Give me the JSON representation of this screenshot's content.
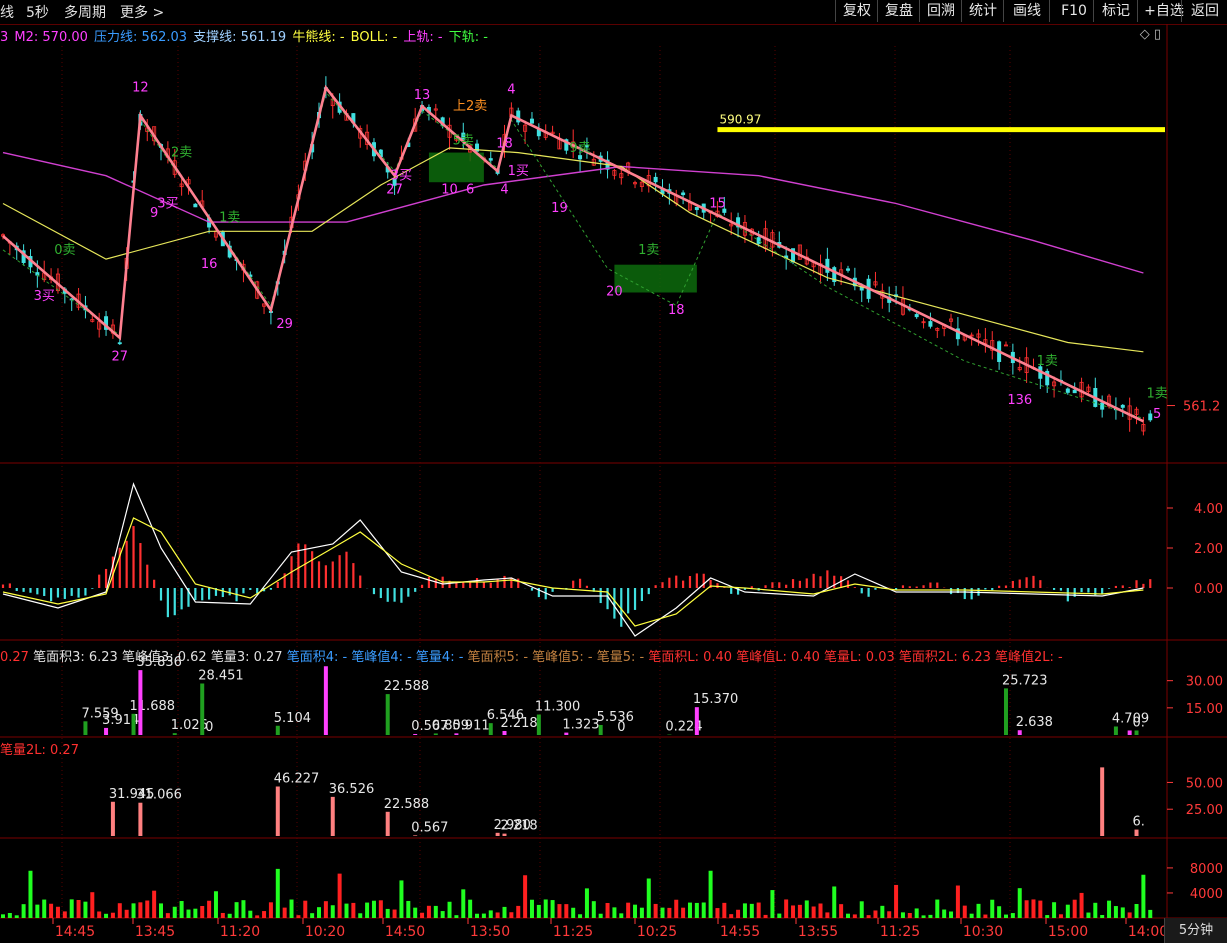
{
  "toolbar": {
    "left": [
      "线",
      "5秒",
      "多周期",
      "更多 >"
    ],
    "buttons": [
      "复权",
      "复盘",
      "回溯",
      "统计",
      "画线",
      "F10",
      "标记",
      "+自选",
      "返回"
    ]
  },
  "legend": [
    {
      "text": "3",
      "color": "#ff40ff"
    },
    {
      "text": "M2: 570.00",
      "color": "#ff40ff"
    },
    {
      "text": "压力线: 562.03",
      "color": "#3a9cff"
    },
    {
      "text": "支撑线: 561.19",
      "color": "#9fd0ff"
    },
    {
      "text": "牛熊线: -",
      "color": "#ffff40"
    },
    {
      "text": "BOLL: -",
      "color": "#ffff40"
    },
    {
      "text": "上轨: -",
      "color": "#ff40ff"
    },
    {
      "text": "下轨: -",
      "color": "#40ff40"
    }
  ],
  "legend2": [
    {
      "text": "0.27",
      "color": "#ff3030"
    },
    {
      "text": "笔面积3: 6.23",
      "color": "#e0e0e0"
    },
    {
      "text": "笔峰值3: 0.62",
      "color": "#e0e0e0"
    },
    {
      "text": "笔量3: 0.27",
      "color": "#e0e0e0"
    },
    {
      "text": "笔面积4: -",
      "color": "#3a9cff"
    },
    {
      "text": "笔峰值4: -",
      "color": "#3a9cff"
    },
    {
      "text": "笔量4: -",
      "color": "#3a9cff"
    },
    {
      "text": "笔面积5: -",
      "color": "#c08040"
    },
    {
      "text": "笔峰值5: -",
      "color": "#c08040"
    },
    {
      "text": "笔量5: -",
      "color": "#c08040"
    },
    {
      "text": "笔面积L: 0.40",
      "color": "#ff3030"
    },
    {
      "text": "笔峰值L: 0.40",
      "color": "#ff3030"
    },
    {
      "text": "笔量L: 0.03",
      "color": "#ff3030"
    },
    {
      "text": "笔面积2L: 6.23",
      "color": "#ff3030"
    },
    {
      "text": "笔峰值2L: -",
      "color": "#ff3030"
    }
  ],
  "legend3": "笔量2L: 0.27",
  "corner_icons": "◇ ▯",
  "bottom_tab": "5分钟",
  "chart_data": [
    {
      "type": "candlestick",
      "panel": "main",
      "current_price": "561.2",
      "price_range": [
        555,
        600
      ],
      "hline": {
        "label": "590.97",
        "value": 590.97
      },
      "pivots": [
        {
          "i": 0,
          "p": 579.5
        },
        {
          "i": 17,
          "p": 568.5,
          "label": "27"
        },
        {
          "i": 20,
          "p": 592.5,
          "label": "12"
        },
        {
          "i": 39,
          "p": 571.5,
          "label": "29"
        },
        {
          "i": 47,
          "p": 595.5
        },
        {
          "i": 57,
          "p": 586.0,
          "label": "27"
        },
        {
          "i": 61,
          "p": 593.5,
          "label": "13"
        },
        {
          "i": 72,
          "p": 586.5,
          "label": "4"
        },
        {
          "i": 74,
          "p": 592.5,
          "label": "4"
        },
        {
          "i": 166,
          "p": 559.5,
          "label": "5"
        }
      ],
      "boll_mid": [
        [
          0,
          583
        ],
        [
          15,
          577
        ],
        [
          30,
          580
        ],
        [
          45,
          580
        ],
        [
          55,
          585
        ],
        [
          65,
          589
        ],
        [
          75,
          588.5
        ],
        [
          90,
          587
        ],
        [
          100,
          582
        ],
        [
          120,
          575
        ],
        [
          140,
          571
        ],
        [
          155,
          568
        ],
        [
          166,
          567
        ]
      ],
      "boll_upper": [
        [
          0,
          588.5
        ],
        [
          15,
          586
        ],
        [
          30,
          581
        ],
        [
          50,
          581
        ],
        [
          70,
          585
        ],
        [
          90,
          587
        ],
        [
          110,
          586
        ],
        [
          130,
          583
        ],
        [
          150,
          579
        ],
        [
          166,
          575.5
        ]
      ],
      "pivot_labels": [
        {
          "text": "12",
          "i": 20,
          "p": 595.5,
          "color": "#ff40ff"
        },
        {
          "text": "27",
          "i": 17,
          "p": 566.5,
          "color": "#ff40ff"
        },
        {
          "text": "29",
          "i": 41,
          "p": 570.0,
          "color": "#ff40ff"
        },
        {
          "text": "27",
          "i": 57,
          "p": 584.5,
          "color": "#ff40ff"
        },
        {
          "text": "13",
          "i": 61,
          "p": 594.7,
          "color": "#ff40ff"
        },
        {
          "text": "4",
          "i": 74,
          "p": 595.3,
          "color": "#ff40ff"
        },
        {
          "text": "4",
          "i": 73,
          "p": 584.5,
          "color": "#ff40ff"
        },
        {
          "text": "9",
          "i": 22,
          "p": 582.0,
          "color": "#ff40ff"
        },
        {
          "text": "16",
          "i": 30,
          "p": 576.5,
          "color": "#ff40ff"
        },
        {
          "text": "10",
          "i": 65,
          "p": 584.5,
          "color": "#ff40ff"
        },
        {
          "text": "6",
          "i": 68,
          "p": 584.5,
          "color": "#ff40ff"
        },
        {
          "text": "18",
          "i": 73,
          "p": 589.5,
          "color": "#ff40ff"
        },
        {
          "text": "19",
          "i": 81,
          "p": 582.5,
          "color": "#ff40ff"
        },
        {
          "text": "20",
          "i": 89,
          "p": 573.5,
          "color": "#ff40ff"
        },
        {
          "text": "18",
          "i": 98,
          "p": 571.5,
          "color": "#ff40ff"
        },
        {
          "text": "15",
          "i": 104,
          "p": 583.0,
          "color": "#ff40ff"
        },
        {
          "text": "136",
          "i": 148,
          "p": 561.8,
          "color": "#ff40ff"
        },
        {
          "text": "5",
          "i": 168,
          "p": 560.3,
          "color": "#ff40ff"
        },
        {
          "text": "上2卖",
          "i": 68,
          "p": 593.5,
          "color": "#ff9020"
        },
        {
          "text": "3买",
          "i": 6,
          "p": 573.0,
          "color": "#ff40ff"
        },
        {
          "text": "3买",
          "i": 24,
          "p": 583.0,
          "color": "#ff40ff"
        },
        {
          "text": "3买",
          "i": 58,
          "p": 586.0,
          "color": "#ff40ff"
        },
        {
          "text": "1买",
          "i": 75,
          "p": 586.5,
          "color": "#ff40ff"
        },
        {
          "text": "2卖",
          "i": 26,
          "p": 588.5,
          "color": "#30b030"
        },
        {
          "text": "1卖",
          "i": 33,
          "p": 581.5,
          "color": "#30b030"
        },
        {
          "text": "0卖",
          "i": 9,
          "p": 578.0,
          "color": "#30b030"
        },
        {
          "text": "5卖",
          "i": 67,
          "p": 589.8,
          "color": "#30b030"
        },
        {
          "text": "9卖",
          "i": 84,
          "p": 589.0,
          "color": "#30b030"
        },
        {
          "text": "1卖",
          "i": 94,
          "p": 578.0,
          "color": "#30b030"
        },
        {
          "text": "1卖",
          "i": 152,
          "p": 566.0,
          "color": "#30b030"
        },
        {
          "text": "1卖",
          "i": 168,
          "p": 562.5,
          "color": "#30b030"
        }
      ]
    },
    {
      "type": "macd",
      "panel": "macd",
      "yticks": [
        "4.00",
        "2.00",
        "0.00"
      ],
      "ylim": [
        -2.6,
        5.4
      ],
      "hist": [
        [
          2,
          -0.2
        ],
        [
          8,
          -0.6
        ],
        [
          12,
          -0.4
        ],
        [
          16,
          1.5
        ],
        [
          19,
          3.0
        ],
        [
          21,
          1.2
        ],
        [
          24,
          -1.5
        ],
        [
          28,
          -0.6
        ],
        [
          34,
          -0.5
        ],
        [
          40,
          0.2
        ],
        [
          43,
          2.3
        ],
        [
          47,
          1.2
        ],
        [
          50,
          1.8
        ],
        [
          54,
          -0.4
        ],
        [
          58,
          -0.8
        ],
        [
          62,
          0.6
        ],
        [
          70,
          0.3
        ],
        [
          74,
          0.6
        ],
        [
          78,
          -0.6
        ],
        [
          84,
          0.4
        ],
        [
          90,
          -1.8
        ],
        [
          95,
          0.2
        ],
        [
          102,
          0.8
        ],
        [
          106,
          -0.3
        ],
        [
          120,
          0.8
        ],
        [
          126,
          -0.3
        ],
        [
          135,
          0.3
        ],
        [
          140,
          -0.5
        ],
        [
          150,
          0.5
        ],
        [
          155,
          -0.5
        ],
        [
          166,
          0.3
        ]
      ],
      "dif": [
        [
          0,
          -0.3
        ],
        [
          8,
          -1.0
        ],
        [
          15,
          -0.2
        ],
        [
          19,
          5.2
        ],
        [
          23,
          2.0
        ],
        [
          28,
          -0.7
        ],
        [
          36,
          -0.8
        ],
        [
          42,
          1.8
        ],
        [
          48,
          2.2
        ],
        [
          52,
          3.4
        ],
        [
          58,
          0.8
        ],
        [
          64,
          0.2
        ],
        [
          70,
          0.4
        ],
        [
          74,
          0.5
        ],
        [
          80,
          -0.4
        ],
        [
          88,
          -0.4
        ],
        [
          92,
          -2.4
        ],
        [
          98,
          -1.0
        ],
        [
          103,
          0.5
        ],
        [
          108,
          -0.2
        ],
        [
          118,
          -0.4
        ],
        [
          124,
          0.7
        ],
        [
          130,
          -0.2
        ],
        [
          140,
          -0.2
        ],
        [
          150,
          -0.3
        ],
        [
          160,
          -0.4
        ],
        [
          166,
          0.0
        ]
      ],
      "dea": [
        [
          0,
          -0.2
        ],
        [
          8,
          -0.8
        ],
        [
          15,
          -0.3
        ],
        [
          19,
          3.5
        ],
        [
          23,
          2.8
        ],
        [
          28,
          0.2
        ],
        [
          36,
          -0.5
        ],
        [
          42,
          0.8
        ],
        [
          48,
          2.0
        ],
        [
          52,
          2.8
        ],
        [
          58,
          1.2
        ],
        [
          64,
          0.3
        ],
        [
          70,
          0.3
        ],
        [
          74,
          0.4
        ],
        [
          80,
          0.0
        ],
        [
          88,
          -0.2
        ],
        [
          92,
          -1.9
        ],
        [
          98,
          -1.3
        ],
        [
          103,
          0.1
        ],
        [
          108,
          0.0
        ],
        [
          118,
          -0.3
        ],
        [
          124,
          0.2
        ],
        [
          130,
          -0.1
        ],
        [
          140,
          -0.1
        ],
        [
          150,
          -0.2
        ],
        [
          160,
          -0.3
        ],
        [
          166,
          -0.1
        ]
      ]
    },
    {
      "type": "bar",
      "panel": "bi_area",
      "yticks": [
        "30.00",
        "15.00"
      ],
      "ylim": [
        0,
        37
      ],
      "bars": [
        {
          "i": 12,
          "v": 7.559,
          "color": "#20a020",
          "label": "7.559"
        },
        {
          "i": 15,
          "v": 3.914,
          "color": "#ff40ff",
          "label": "3.914"
        },
        {
          "i": 19,
          "v": 11.688,
          "color": "#20a020",
          "label": "11.688"
        },
        {
          "i": 20,
          "v": 35.836,
          "color": "#ff40ff",
          "label": "35.836"
        },
        {
          "i": 25,
          "v": 1.026,
          "color": "#20a020",
          "label": "1.026"
        },
        {
          "i": 29,
          "v": 28.451,
          "color": "#20a020",
          "label": "28.451"
        },
        {
          "i": 30,
          "v": 0,
          "color": "#ff40ff",
          "label": "0"
        },
        {
          "i": 40,
          "v": 5.104,
          "color": "#20a020",
          "label": "5.104"
        },
        {
          "i": 47,
          "v": 38.0,
          "color": "#ff40ff",
          "label": ""
        },
        {
          "i": 56,
          "v": 22.588,
          "color": "#20a020",
          "label": "22.588"
        },
        {
          "i": 60,
          "v": 0.567,
          "color": "#ff40ff",
          "label": "0.567"
        },
        {
          "i": 63,
          "v": 0.859,
          "color": "#20a020",
          "label": "0.859"
        },
        {
          "i": 66,
          "v": 0.911,
          "color": "#ff40ff",
          "label": "0.911"
        },
        {
          "i": 71,
          "v": 6.546,
          "color": "#20a020",
          "label": "6.546"
        },
        {
          "i": 73,
          "v": 2.218,
          "color": "#ff40ff",
          "label": "2.218"
        },
        {
          "i": 78,
          "v": 11.3,
          "color": "#20a020",
          "label": "11.300"
        },
        {
          "i": 82,
          "v": 1.323,
          "color": "#ff40ff",
          "label": "1.323"
        },
        {
          "i": 87,
          "v": 5.536,
          "color": "#20a020",
          "label": "5.536"
        },
        {
          "i": 90,
          "v": 0,
          "color": "#ff40ff",
          "label": "0"
        },
        {
          "i": 97,
          "v": 0.224,
          "color": "#20a020",
          "label": "0.224"
        },
        {
          "i": 101,
          "v": 15.37,
          "color": "#ff40ff",
          "label": "15.370"
        },
        {
          "i": 146,
          "v": 25.723,
          "color": "#20a020",
          "label": "25.723"
        },
        {
          "i": 148,
          "v": 2.638,
          "color": "#ff40ff",
          "label": "2.638"
        },
        {
          "i": 162,
          "v": 4.709,
          "color": "#20a020",
          "label": "4.709"
        },
        {
          "i": 164,
          "v": 2.5,
          "color": "#ff40ff",
          "label": ""
        },
        {
          "i": 165,
          "v": 2.5,
          "color": "#20a020",
          "label": "0."
        }
      ]
    },
    {
      "type": "bar",
      "panel": "bi_vol",
      "yticks": [
        "50.00",
        "25.00"
      ],
      "ylim": [
        0,
        70
      ],
      "bars": [
        {
          "i": 16,
          "v": 31.945,
          "color": "#ff8080",
          "label": "31.945"
        },
        {
          "i": 20,
          "v": 31.066,
          "color": "#ff8080",
          "label": "31.066"
        },
        {
          "i": 40,
          "v": 46.227,
          "color": "#ff8080",
          "label": "46.227"
        },
        {
          "i": 48,
          "v": 36.526,
          "color": "#ff8080",
          "label": "36.526"
        },
        {
          "i": 56,
          "v": 22.588,
          "color": "#ff8080",
          "label": "22.588"
        },
        {
          "i": 60,
          "v": 0.567,
          "color": "#ff8080",
          "label": "0.567"
        },
        {
          "i": 72,
          "v": 2.98,
          "color": "#ff8080",
          "label": "2.980"
        },
        {
          "i": 73,
          "v": 2.218,
          "color": "#ff8080",
          "label": "2.218"
        },
        {
          "i": 160,
          "v": 64.0,
          "color": "#ff8080",
          "label": ""
        },
        {
          "i": 165,
          "v": 6.0,
          "color": "#ff8080",
          "label": "6."
        }
      ]
    },
    {
      "type": "bar",
      "panel": "volume",
      "yticks": [
        "8000",
        "4000"
      ],
      "ylim": [
        0,
        11500
      ]
    }
  ],
  "x_tick_labels": [
    "14:45",
    "13:45",
    "11:20",
    "10:20",
    "14:50",
    "13:50",
    "11:25",
    "10:25",
    "14:55",
    "13:55",
    "11:25",
    "10:30",
    "15:00",
    "14:00"
  ]
}
